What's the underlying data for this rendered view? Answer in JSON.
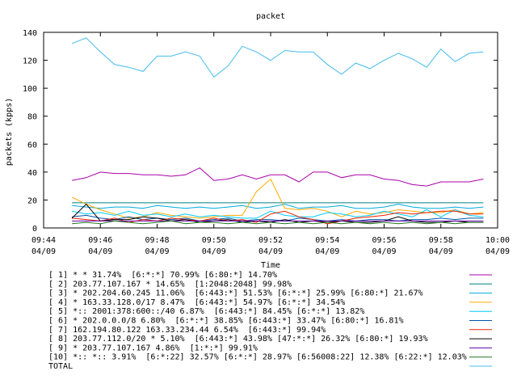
{
  "chart_data": {
    "type": "line",
    "title": "packet",
    "xlabel": "Time",
    "ylabel": "packets (kpps)",
    "ylim": [
      0,
      140
    ],
    "y_ticks": [
      0,
      20,
      40,
      60,
      80,
      100,
      120,
      140
    ],
    "x_ticks": [
      {
        "time": "09:44",
        "date": "04/09"
      },
      {
        "time": "09:46",
        "date": "04/09"
      },
      {
        "time": "09:48",
        "date": "04/09"
      },
      {
        "time": "09:50",
        "date": "04/09"
      },
      {
        "time": "09:52",
        "date": "04/09"
      },
      {
        "time": "09:54",
        "date": "04/09"
      },
      {
        "time": "09:56",
        "date": "04/09"
      },
      {
        "time": "09:58",
        "date": "04/09"
      },
      {
        "time": "10:00",
        "date": "04/09"
      }
    ],
    "xlim": [
      "09:44",
      "10:00"
    ],
    "grid": false,
    "legend_position": "bottom",
    "x": [
      "09:45",
      "09:45:30",
      "09:46",
      "09:46:30",
      "09:47",
      "09:47:30",
      "09:48",
      "09:48:30",
      "09:49",
      "09:49:30",
      "09:50",
      "09:50:30",
      "09:51",
      "09:51:30",
      "09:52",
      "09:52:30",
      "09:53",
      "09:53:30",
      "09:54",
      "09:54:30",
      "09:55",
      "09:55:30",
      "09:56",
      "09:56:30",
      "09:57",
      "09:57:30",
      "09:58",
      "09:58:30",
      "09:59",
      "09:59:30"
    ],
    "series": [
      {
        "name": "[ 1] * * 31.74%  [6:*:*] 70.99% [6:80:*] 14.70%",
        "color": "#aa00aa",
        "values": [
          34,
          36,
          40,
          39,
          39,
          38,
          38,
          37,
          38,
          43,
          34,
          35,
          38,
          35,
          38,
          38,
          33,
          40,
          40,
          36,
          38,
          38,
          35,
          34,
          31,
          30,
          33,
          33,
          33,
          35
        ]
      },
      {
        "name": "[ 2] 203.77.107.167 * 14.65%  [1:2048:2048] 99.98%",
        "color": "#008080",
        "values": [
          18,
          18,
          18,
          18,
          18,
          18,
          18,
          18,
          18,
          18,
          18,
          18,
          18,
          18,
          18,
          18,
          18,
          18,
          18,
          18,
          18,
          18,
          18,
          18,
          18,
          18,
          18,
          18,
          18,
          18
        ]
      },
      {
        "name": "[ 3] * 202.204.60.245 11.06%  [6:443:*] 51.53% [6:*:*] 25.99% [6:80:*] 21.67%",
        "color": "#00aadd",
        "values": [
          16,
          15,
          14,
          15,
          15,
          14,
          16,
          15,
          14,
          15,
          14,
          15,
          16,
          14,
          15,
          17,
          14,
          15,
          15,
          16,
          14,
          14,
          15,
          17,
          15,
          14,
          14,
          15,
          14,
          15
        ]
      },
      {
        "name": "[ 4] * 163.33.128.0/17 8.47%  [6:443:*] 54.97% [6:*:*] 34.54%",
        "color": "#ffaa00",
        "values": [
          22,
          17,
          13,
          10,
          7,
          8,
          11,
          9,
          8,
          7,
          8,
          9,
          9,
          26,
          35,
          14,
          13,
          14,
          12,
          8,
          12,
          10,
          11,
          13,
          12,
          11,
          11,
          13,
          10,
          11
        ]
      },
      {
        "name": "[ 5] *:: 2001:378:600::/40 6.87%  [6:443:*] 84.45% [6:*:*] 13.82%",
        "color": "#00ccff",
        "values": [
          12,
          10,
          11,
          9,
          12,
          9,
          10,
          8,
          10,
          8,
          9,
          8,
          7,
          7,
          12,
          9,
          8,
          8,
          11,
          10,
          8,
          9,
          12,
          10,
          8,
          13,
          8,
          13,
          9,
          8
        ]
      },
      {
        "name": "[ 6] * 202.0.0.0/8 6.80%  [6:*:*] 38.85% [6:443:*] 33.47% [6:80:*] 16.81%",
        "color": "#0055aa",
        "values": [
          8,
          9,
          7,
          6,
          8,
          6,
          7,
          6,
          7,
          5,
          6,
          7,
          5,
          6,
          6,
          5,
          7,
          6,
          5,
          6,
          5,
          6,
          6,
          5,
          6,
          6,
          7,
          6,
          7,
          7
        ]
      },
      {
        "name": "[ 7] 162.194.80.122 163.33.234.44 6.54%  [6:443:*] 99.94%",
        "color": "#ee2200",
        "values": [
          7,
          6,
          5,
          7,
          4,
          6,
          5,
          7,
          6,
          5,
          7,
          5,
          6,
          4,
          10,
          12,
          8,
          6,
          3,
          5,
          7,
          8,
          9,
          11,
          10,
          11,
          12,
          12,
          10,
          10
        ]
      },
      {
        "name": "[ 8] 203.77.112.0/20 * 5.10%  [6:443:*] 43.98% [47:*:*] 26.32% [6:80:*] 19.93%",
        "color": "#000000",
        "values": [
          7,
          17,
          5,
          6,
          6,
          8,
          7,
          5,
          6,
          4,
          5,
          6,
          4,
          5,
          4,
          6,
          4,
          5,
          4,
          5,
          4,
          4,
          5,
          8,
          5,
          4,
          4,
          5,
          4,
          4
        ]
      },
      {
        "name": "[ 9] * 203.77.107.167 4.86%  [1:*:*] 99.91%",
        "color": "#6600aa",
        "values": [
          5,
          5,
          5,
          5,
          5,
          5,
          5,
          5,
          5,
          5,
          5,
          5,
          5,
          5,
          5,
          5,
          5,
          5,
          5,
          5,
          5,
          5,
          5,
          5,
          5,
          5,
          5,
          5,
          5,
          5
        ]
      },
      {
        "name": "[10] *:: *:: 3.91%  [6:*:22] 32.57% [6:*:*] 28.97% [6:56008:22] 12.38% [6:22:*] 12.03%",
        "color": "#227722",
        "values": [
          3,
          4,
          3,
          5,
          4,
          3,
          4,
          5,
          3,
          4,
          4,
          3,
          4,
          3,
          4,
          3,
          4,
          3,
          4,
          3,
          4,
          3,
          4,
          3,
          4,
          3,
          4,
          3,
          4,
          4
        ]
      },
      {
        "name": "TOTAL",
        "color": "#44bbee",
        "values": [
          132,
          136,
          126,
          117,
          115,
          112,
          123,
          123,
          126,
          123,
          108,
          116,
          130,
          126,
          120,
          127,
          126,
          126,
          117,
          110,
          118,
          114,
          120,
          125,
          121,
          115,
          128,
          119,
          125,
          126
        ]
      }
    ]
  }
}
